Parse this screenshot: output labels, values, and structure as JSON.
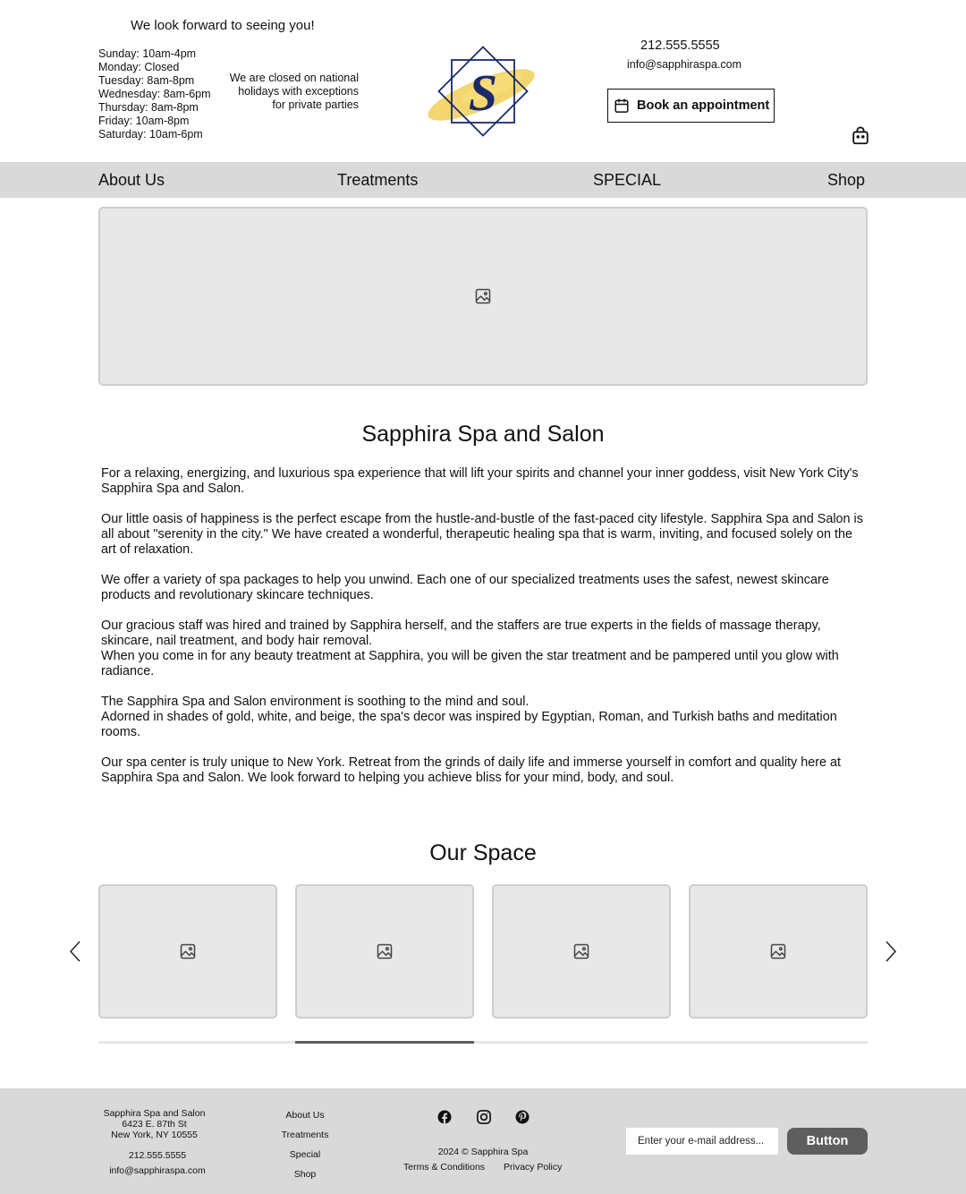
{
  "header": {
    "greeting": "We look forward to seeing you!",
    "hours": [
      "Sunday: 10am-4pm",
      "Monday: Closed",
      "Tuesday: 8am-8pm",
      "Wednesday: 8am-6pm",
      "Thursday: 8am-8pm",
      "Friday: 10am-8pm",
      "Saturday: 10am-6pm"
    ],
    "closed_note_lines": [
      "We are closed on national",
      "holidays with exceptions",
      "for private parties"
    ],
    "logo_letter": "S",
    "phone": "212.555.5555",
    "email": "info@sapphiraspa.com",
    "book_label": "Book an appointment"
  },
  "nav": {
    "items": [
      "About Us",
      "Treatments",
      "SPECIAL",
      "Shop"
    ]
  },
  "about": {
    "title": "Sapphira Spa and Salon",
    "paragraphs": [
      [
        "For a relaxing, energizing, and luxurious spa experience that will lift your spirits and channel your inner goddess, visit New York City's Sapphira Spa and Salon."
      ],
      [
        "Our little oasis of happiness is the perfect escape from the hustle-and-bustle of the fast-paced city lifestyle. Sapphira Spa and Salon is all about \"serenity in the city.\" We have created a wonderful, therapeutic healing spa that is warm, inviting, and focused solely on the art of relaxation."
      ],
      [
        "We offer a variety of spa packages to help you unwind. Each one of our specialized treatments uses the safest, newest skincare products and revolutionary skincare techniques."
      ],
      [
        "Our gracious staff was hired and trained by Sapphira herself, and the staffers are true experts in the fields of massage therapy, skincare, nail treatment, and body hair removal.",
        "When you come in for any beauty treatment at Sapphira, you will be given the star treatment and be pampered until you glow with radiance."
      ],
      [
        "The Sapphira Spa and Salon environment is soothing to the mind and soul.",
        "Adorned in shades of gold, white, and beige, the spa's decor was inspired by Egyptian, Roman, and Turkish baths and meditation rooms."
      ],
      [
        "Our spa center is truly unique to New York. Retreat from the grinds of daily life and immerse yourself in comfort and quality here at Sapphira Spa and Salon. We look forward to helping you achieve bliss for your mind, body, and soul."
      ]
    ]
  },
  "gallery": {
    "title": "Our Space",
    "tile_count": 4,
    "scroll_position": 0.25
  },
  "footer": {
    "address_lines": [
      "Sapphira Spa and Salon",
      "6423 E. 87th St",
      "New York, NY 10555"
    ],
    "phone": "212.555.5555",
    "email": "info@sapphiraspa.com",
    "links": [
      "About Us",
      "Treatments",
      "Special",
      "Shop"
    ],
    "social_icons": [
      "facebook-icon",
      "instagram-icon",
      "pinterest-icon"
    ],
    "copyright": "2024 © Sapphira Spa",
    "terms": "Terms & Conditions",
    "privacy": "Privacy Policy",
    "email_placeholder": "Enter your e-mail address...",
    "button_label": "Button"
  },
  "colors": {
    "nav_bg": "#d9d9d9",
    "logo_blue": "#1b2a6b",
    "logo_gold": "#f2cf55",
    "placeholder_bg": "#e8e8e8",
    "button_dark": "#5e5e5e"
  }
}
